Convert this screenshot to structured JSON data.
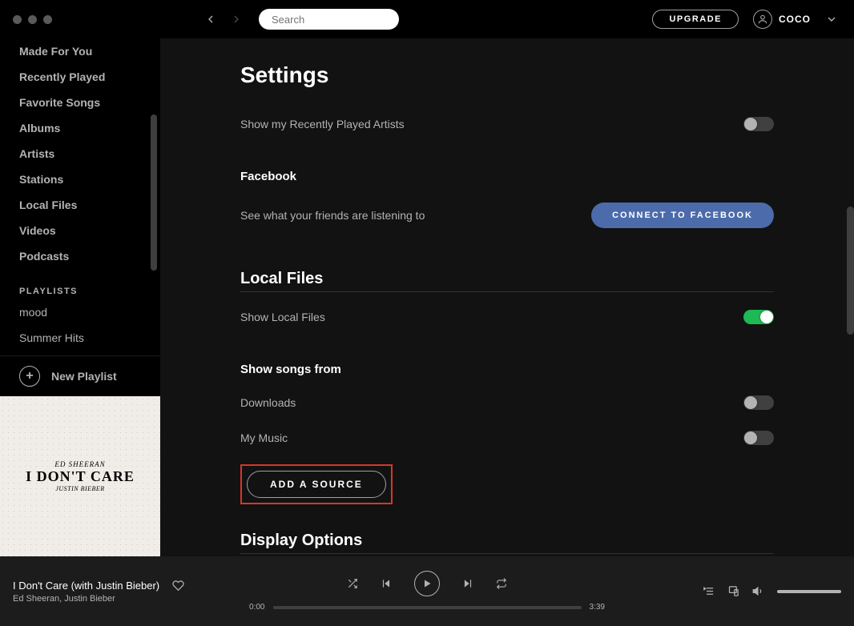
{
  "search": {
    "placeholder": "Search"
  },
  "top": {
    "upgrade": "UPGRADE",
    "username": "COCO"
  },
  "sidebar": {
    "items": [
      "Made For You",
      "Recently Played",
      "Favorite Songs",
      "Albums",
      "Artists",
      "Stations",
      "Local Files",
      "Videos",
      "Podcasts"
    ],
    "playlists_header": "PLAYLISTS",
    "playlists": [
      "mood",
      "Summer Hits"
    ],
    "new_playlist": "New Playlist",
    "art": {
      "line1": "ED SHEERAN",
      "line2": "I DON'T CARE",
      "line3": "JUSTIN BIEBER"
    }
  },
  "settings": {
    "title": "Settings",
    "recentlyPlayedArtists": "Show my Recently Played Artists",
    "facebook_header": "Facebook",
    "facebook_desc": "See what your friends are listening to",
    "facebook_btn": "CONNECT TO FACEBOOK",
    "localfiles_header": "Local Files",
    "show_local_files": "Show Local Files",
    "show_songs_from": "Show songs from",
    "downloads": "Downloads",
    "mymusic": "My Music",
    "add_source": "ADD A SOURCE",
    "display_options": "Display Options"
  },
  "player": {
    "title": "I Don't Care (with Justin Bieber)",
    "artist": "Ed Sheeran, Justin Bieber",
    "elapsed": "0:00",
    "total": "3:39"
  }
}
